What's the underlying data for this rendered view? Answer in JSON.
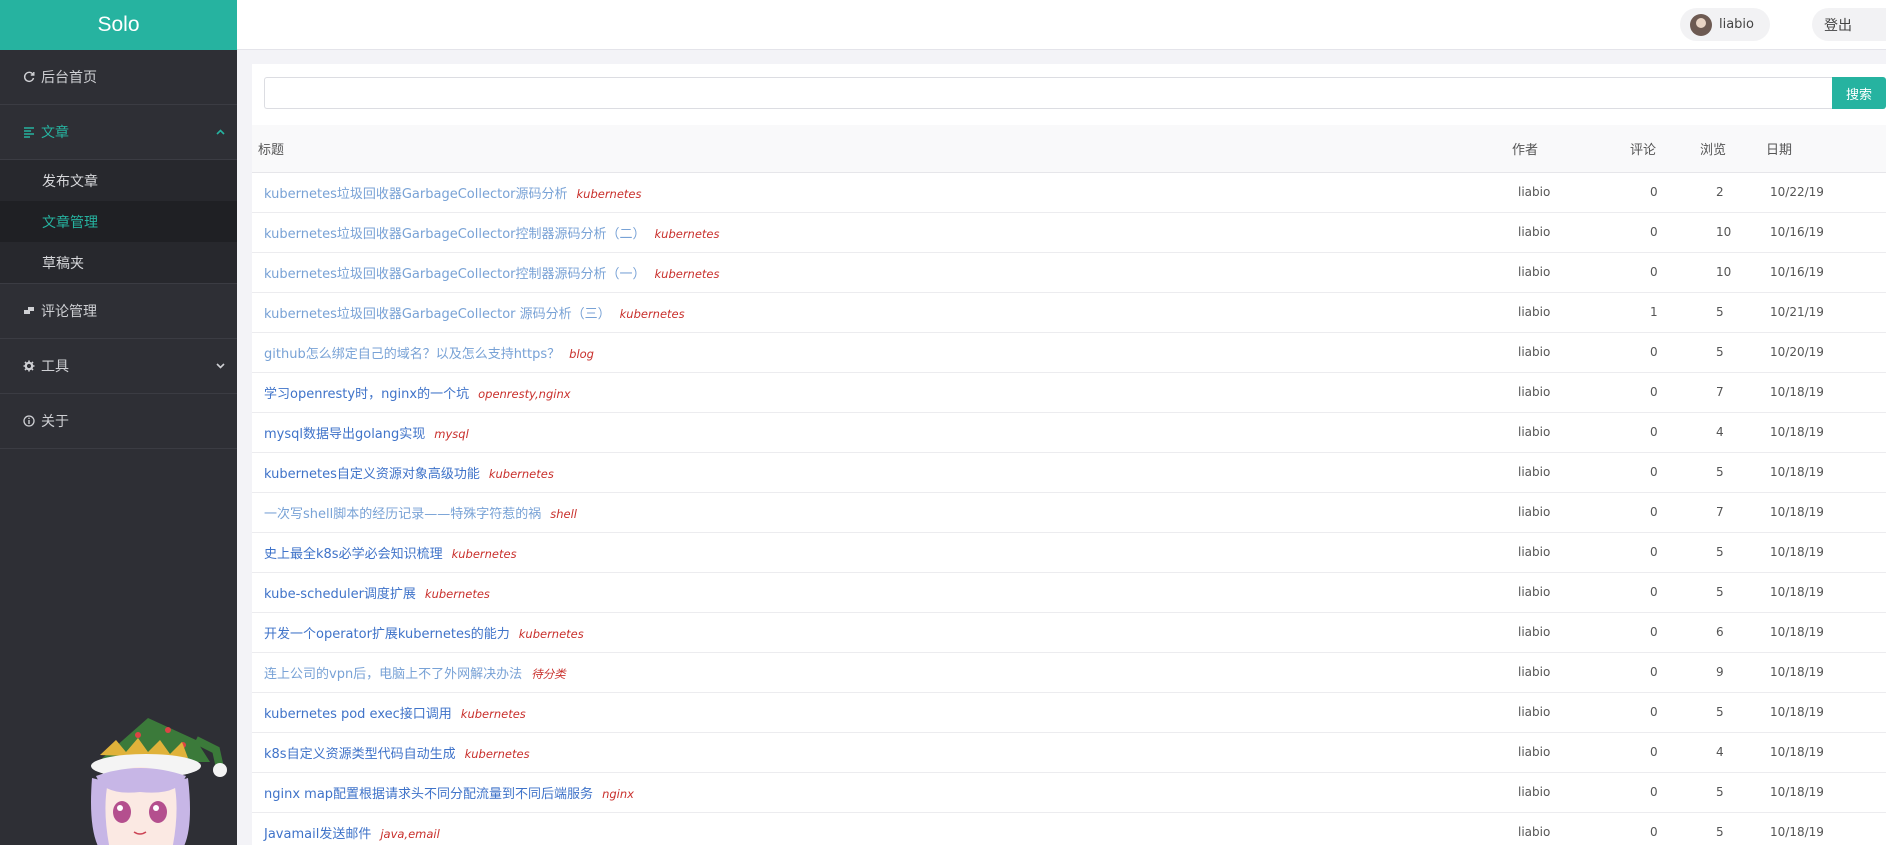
{
  "brand": "Solo",
  "nav": {
    "home": {
      "label": "后台首页",
      "icon": "refresh-icon"
    },
    "articles": {
      "label": "文章",
      "icon": "list-icon"
    },
    "articles_sub": [
      {
        "label": "发布文章"
      },
      {
        "label": "文章管理"
      },
      {
        "label": "草稿夹"
      }
    ],
    "comments": {
      "label": "评论管理",
      "icon": "comments-icon"
    },
    "tools": {
      "label": "工具",
      "icon": "gear-icon"
    },
    "about": {
      "label": "关于",
      "icon": "info-icon"
    }
  },
  "topbar": {
    "username": "liabio",
    "logout": "登出"
  },
  "search": {
    "value": "",
    "placeholder": "",
    "button": "搜索"
  },
  "table": {
    "headers": {
      "title": "标题",
      "author": "作者",
      "comments": "评论",
      "views": "浏览",
      "date": "日期"
    },
    "rows": [
      {
        "title": "kubernetes垃圾回收器GarbageCollector源码分析",
        "tags": "kubernetes",
        "author": "liabio",
        "comments": "0",
        "views": "2",
        "date": "10/22/19",
        "visited": true
      },
      {
        "title": "kubernetes垃圾回收器GarbageCollector控制器源码分析（二）",
        "tags": "kubernetes",
        "author": "liabio",
        "comments": "0",
        "views": "10",
        "date": "10/16/19",
        "visited": true
      },
      {
        "title": "kubernetes垃圾回收器GarbageCollector控制器源码分析（一）",
        "tags": "kubernetes",
        "author": "liabio",
        "comments": "0",
        "views": "10",
        "date": "10/16/19",
        "visited": true
      },
      {
        "title": "kubernetes垃圾回收器GarbageCollector 源码分析（三）",
        "tags": "kubernetes",
        "author": "liabio",
        "comments": "1",
        "views": "5",
        "date": "10/21/19",
        "visited": true
      },
      {
        "title": "github怎么绑定自己的域名？以及怎么支持https？",
        "tags": "blog",
        "author": "liabio",
        "comments": "0",
        "views": "5",
        "date": "10/20/19",
        "visited": true
      },
      {
        "title": "学习openresty时，nginx的一个坑",
        "tags": "openresty,nginx",
        "author": "liabio",
        "comments": "0",
        "views": "7",
        "date": "10/18/19",
        "visited": false
      },
      {
        "title": "mysql数据导出golang实现",
        "tags": "mysql",
        "author": "liabio",
        "comments": "0",
        "views": "4",
        "date": "10/18/19",
        "visited": false
      },
      {
        "title": "kubernetes自定义资源对象高级功能",
        "tags": "kubernetes",
        "author": "liabio",
        "comments": "0",
        "views": "5",
        "date": "10/18/19",
        "visited": false
      },
      {
        "title": "一次写shell脚本的经历记录——特殊字符惹的祸",
        "tags": "shell",
        "author": "liabio",
        "comments": "0",
        "views": "7",
        "date": "10/18/19",
        "visited": true
      },
      {
        "title": "史上最全k8s必学必会知识梳理",
        "tags": "kubernetes",
        "author": "liabio",
        "comments": "0",
        "views": "5",
        "date": "10/18/19",
        "visited": false
      },
      {
        "title": "kube-scheduler调度扩展",
        "tags": "kubernetes",
        "author": "liabio",
        "comments": "0",
        "views": "5",
        "date": "10/18/19",
        "visited": false
      },
      {
        "title": "开发一个operator扩展kubernetes的能力",
        "tags": "kubernetes",
        "author": "liabio",
        "comments": "0",
        "views": "6",
        "date": "10/18/19",
        "visited": false
      },
      {
        "title": "连上公司的vpn后，电脑上不了外网解决办法",
        "tags": "待分类",
        "author": "liabio",
        "comments": "0",
        "views": "9",
        "date": "10/18/19",
        "visited": true
      },
      {
        "title": "kubernetes pod exec接口调用",
        "tags": "kubernetes",
        "author": "liabio",
        "comments": "0",
        "views": "5",
        "date": "10/18/19",
        "visited": false
      },
      {
        "title": "k8s自定义资源类型代码自动生成",
        "tags": "kubernetes",
        "author": "liabio",
        "comments": "0",
        "views": "4",
        "date": "10/18/19",
        "visited": false
      },
      {
        "title": "nginx map配置根据请求头不同分配流量到不同后端服务",
        "tags": "nginx",
        "author": "liabio",
        "comments": "0",
        "views": "5",
        "date": "10/18/19",
        "visited": false
      },
      {
        "title": "Javamail发送邮件",
        "tags": "java,email",
        "author": "liabio",
        "comments": "0",
        "views": "5",
        "date": "10/18/19",
        "visited": false
      }
    ]
  },
  "colors": {
    "accent": "#26b3a0",
    "sidebar": "#2e2f35",
    "link": "#3f73c9",
    "link_visited": "#78a2d6",
    "tag": "#c9302c"
  }
}
